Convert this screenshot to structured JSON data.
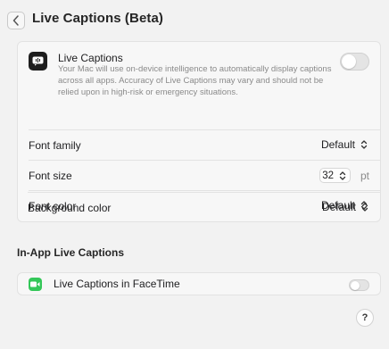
{
  "header": {
    "title": "Live Captions (Beta)",
    "back_icon": "chevron-left-icon"
  },
  "live_captions": {
    "icon": "live-captions-app-icon",
    "title": "Live Captions",
    "description": "Your Mac will use on-device intelligence to automatically display captions across all apps. Accuracy of Live Captions may vary and should not be relied upon in high-risk or emergency situations.",
    "enabled": false
  },
  "settings": {
    "font_family": {
      "label": "Font family",
      "value": "Default"
    },
    "font_size": {
      "label": "Font size",
      "value": "32",
      "unit": "pt"
    },
    "font_color": {
      "label": "Font color",
      "value": "Default"
    },
    "background_color": {
      "label": "Background color",
      "value": "Default"
    }
  },
  "in_app": {
    "section_title": "In-App Live Captions",
    "facetime": {
      "icon": "facetime-icon",
      "label": "Live Captions in FaceTime",
      "enabled": false
    }
  },
  "help": {
    "label": "?"
  },
  "colors": {
    "background": "#f2f2f2",
    "card": "#f7f7f7",
    "facetime_green": "#34c759",
    "toggle_off": "#e4e4e4"
  }
}
